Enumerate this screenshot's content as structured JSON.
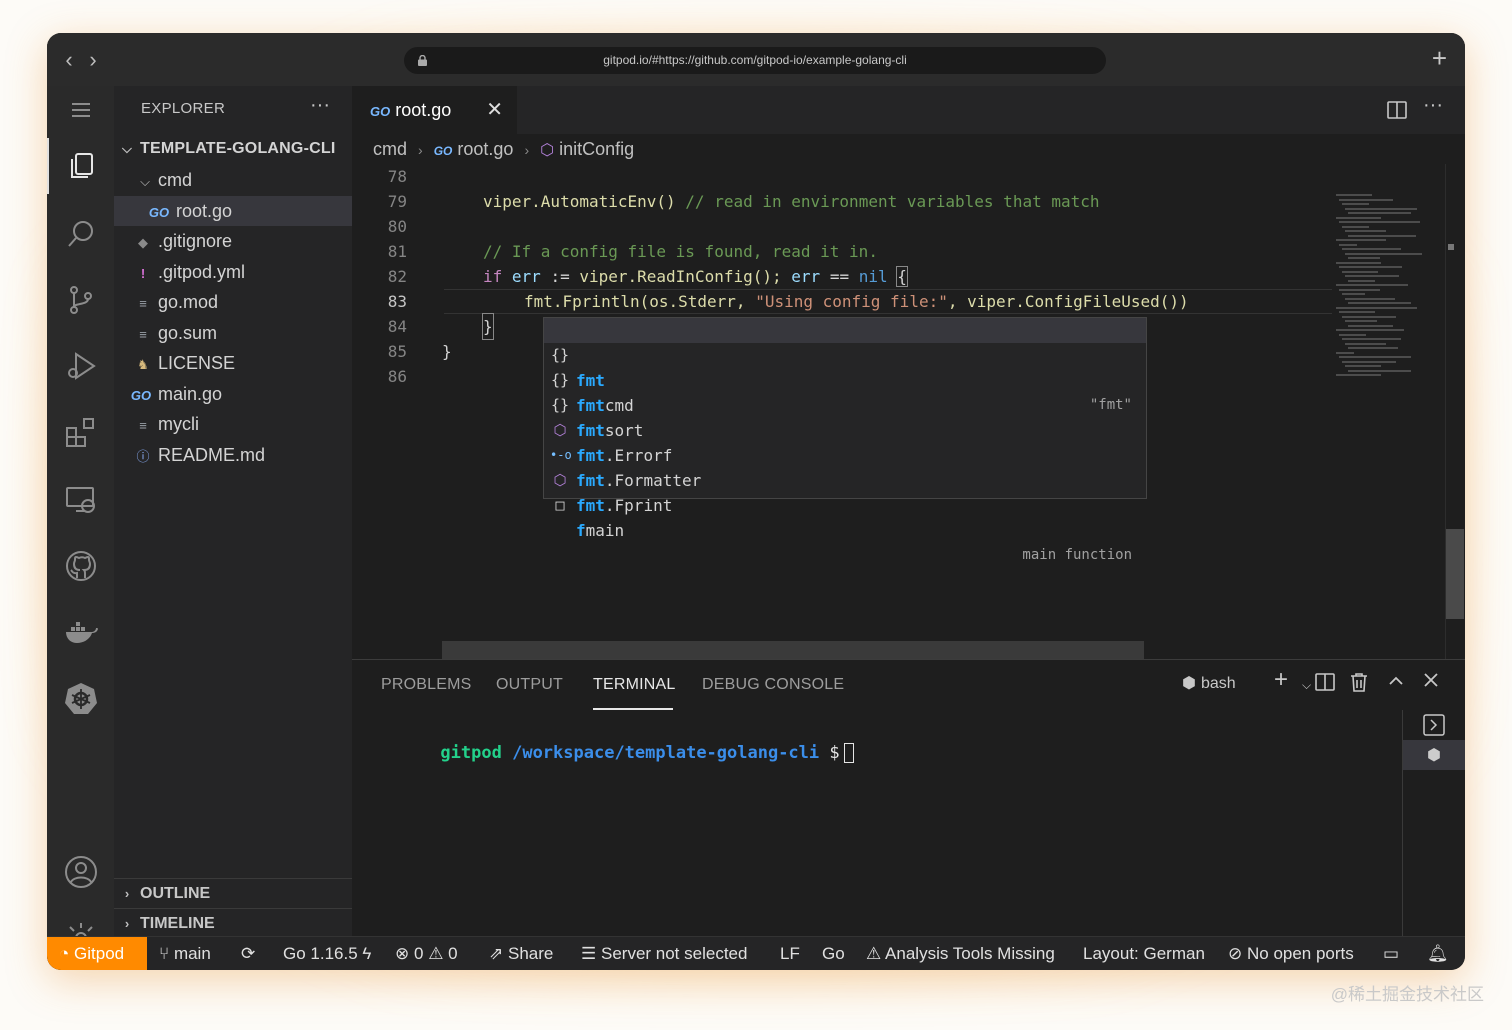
{
  "browser": {
    "url": "gitpod.io/#https://github.com/gitpod-io/example-golang-cli",
    "new_tab": "+"
  },
  "activity_icons": [
    "explorer-icon",
    "search-icon",
    "source-control-icon",
    "run-debug-icon",
    "extensions-icon",
    "remote-explorer-icon",
    "github-icon",
    "docker-icon",
    "kubernetes-icon",
    "account-icon",
    "settings-gear-icon"
  ],
  "sidebar": {
    "title": "EXPLORER",
    "more": "···",
    "root": "TEMPLATE-GOLANG-CLI",
    "items": [
      {
        "label": "cmd",
        "icon": "chevron-down-icon"
      },
      {
        "label": "root.go",
        "icon": "go-file-icon"
      },
      {
        "label": ".gitignore",
        "icon": "git-file-icon"
      },
      {
        "label": ".gitpod.yml",
        "icon": "yaml-file-icon"
      },
      {
        "label": "go.mod",
        "icon": "text-file-icon"
      },
      {
        "label": "go.sum",
        "icon": "text-file-icon"
      },
      {
        "label": "LICENSE",
        "icon": "license-file-icon"
      },
      {
        "label": "main.go",
        "icon": "go-file-icon"
      },
      {
        "label": "mycli",
        "icon": "text-file-icon"
      },
      {
        "label": "README.md",
        "icon": "info-file-icon"
      }
    ],
    "outline": "OUTLINE",
    "timeline": "TIMELINE"
  },
  "editor": {
    "tab_label": "root.go",
    "go_badge": "GO",
    "breadcrumb": {
      "folder": "cmd",
      "file": "root.go",
      "symbol": "initConfig"
    },
    "line_numbers": [
      "78",
      "79",
      "80",
      "81",
      "82",
      "83",
      "84",
      "85",
      "86"
    ],
    "code": {
      "l79_fn": "viper.AutomaticEnv()",
      "l79_cm": "// read in environment variables that match",
      "l81_cm": "// If a config file is found, read it in.",
      "l82_if": "if",
      "l82_err": "err",
      "l82_op": " := ",
      "l82_call": "viper.ReadInConfig();",
      "l82_err2": "err",
      "l82_eq": " == ",
      "l82_nil": "nil",
      "l82_brace": "{",
      "l83_a": "fmt.Fprintln(os.Stderr, ",
      "l83_str": "\"Using config file:\"",
      "l83_b": ", viper.ConfigFileUsed())",
      "l84": "}",
      "l85": "}"
    }
  },
  "suggest": {
    "items": [
      {
        "icon": "{}",
        "match": "fmt",
        "rest": "",
        "detail": "\"fmt\""
      },
      {
        "icon": "{}",
        "match": "fmt",
        "rest": "cmd",
        "detail": ""
      },
      {
        "icon": "{}",
        "match": "fmt",
        "rest": "sort",
        "detail": ""
      },
      {
        "icon": "⬡",
        "match": "fmt",
        "rest": ".Errorf",
        "detail": ""
      },
      {
        "icon": "•-o",
        "match": "fmt",
        "rest": ".Formatter",
        "detail": ""
      },
      {
        "icon": "⬡",
        "match": "fmt",
        "rest": ".Fprint",
        "detail": ""
      },
      {
        "icon": "□",
        "match": "f",
        "rest": "main",
        "detail": "main function"
      }
    ]
  },
  "panel": {
    "tabs": [
      "PROBLEMS",
      "OUTPUT",
      "TERMINAL",
      "DEBUG CONSOLE"
    ],
    "shell": "bash",
    "terminal": {
      "user": "gitpod",
      "path": "/workspace/template-golang-cli",
      "prompt": "$"
    }
  },
  "statusbar": {
    "gitpod": "Gitpod",
    "branch": "main",
    "go_version": "Go 1.16.5",
    "errors": "0",
    "warnings": "0",
    "share": "Share",
    "server": "Server not selected",
    "eol": "LF",
    "language": "Go",
    "analysis": "Analysis Tools Missing",
    "layout": "Layout: German",
    "ports": "No open ports"
  },
  "watermark": "@稀土掘金技术社区"
}
